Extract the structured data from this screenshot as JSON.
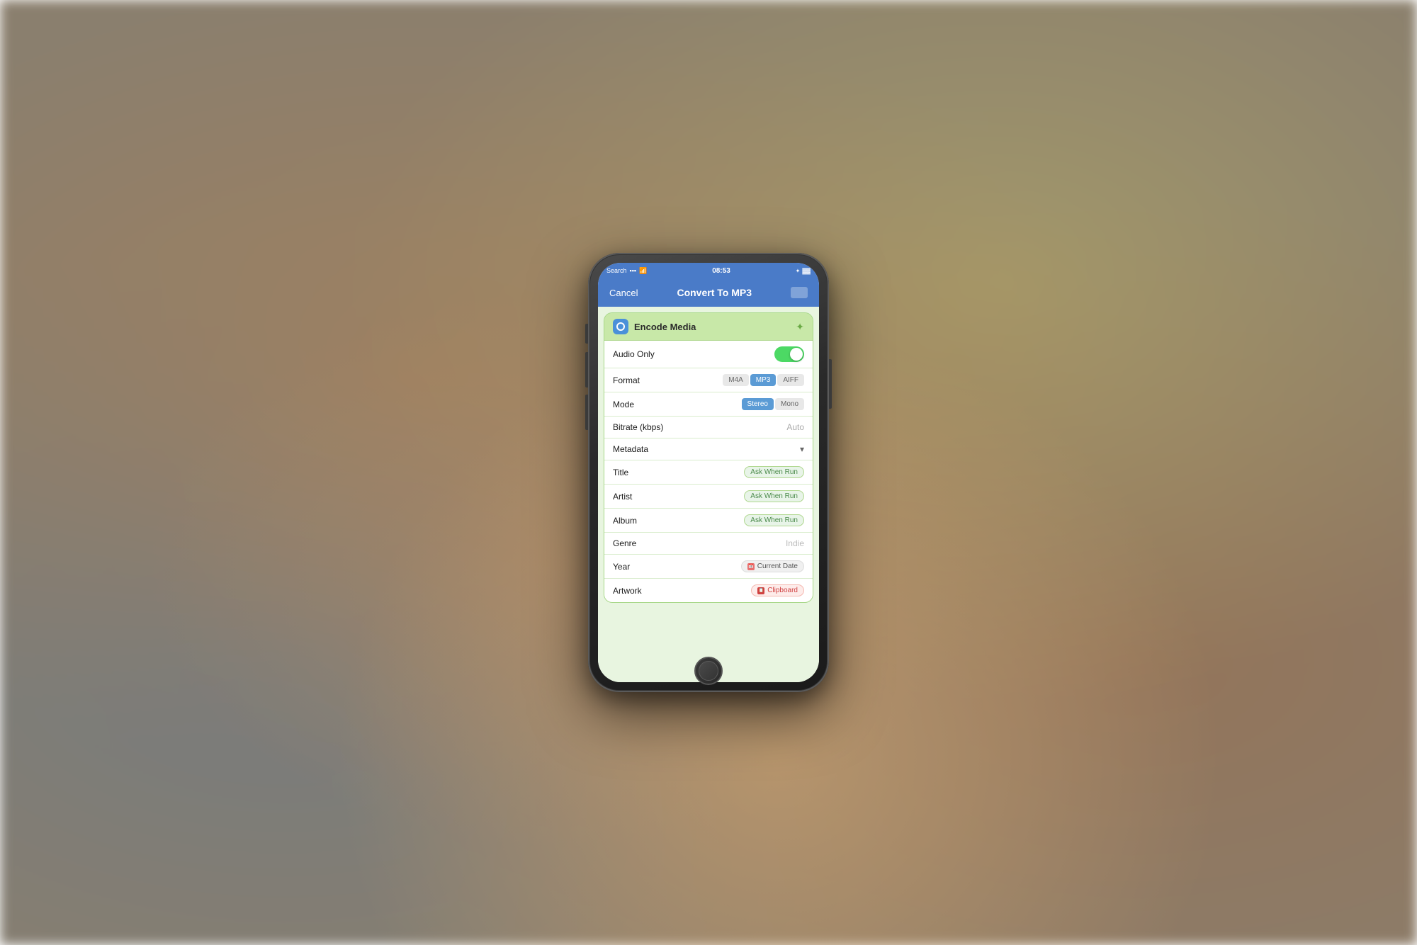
{
  "background": {
    "color": "#8a7f6e"
  },
  "status_bar": {
    "left_text": "Search",
    "time": "08:53",
    "right_icons": "▪ ✦ 🔋"
  },
  "nav": {
    "cancel_label": "Cancel",
    "title": "Convert To MP3",
    "icon_label": "□"
  },
  "card": {
    "header": {
      "icon": "encode",
      "title": "Encode Media",
      "expand_icon": "✦"
    },
    "rows": [
      {
        "id": "audio-only",
        "label": "Audio Only",
        "control": "toggle",
        "toggle_on": true
      },
      {
        "id": "format",
        "label": "Format",
        "control": "segmented",
        "options": [
          "M4A",
          "MP3",
          "AIFF"
        ],
        "selected": "MP3"
      },
      {
        "id": "mode",
        "label": "Mode",
        "control": "segmented",
        "options": [
          "Stereo",
          "Mono"
        ],
        "selected": "Stereo"
      },
      {
        "id": "bitrate",
        "label": "Bitrate (kbps)",
        "control": "text",
        "value": "Auto"
      },
      {
        "id": "metadata",
        "label": "Metadata",
        "control": "expand",
        "chevron": "▾"
      },
      {
        "id": "title",
        "label": "Title",
        "control": "badge",
        "badge_text": "Ask When Run",
        "badge_type": "ask"
      },
      {
        "id": "artist",
        "label": "Artist",
        "control": "badge",
        "badge_text": "Ask When Run",
        "badge_type": "ask"
      },
      {
        "id": "album",
        "label": "Album",
        "control": "badge",
        "badge_text": "Ask When Run",
        "badge_type": "ask"
      },
      {
        "id": "genre",
        "label": "Genre",
        "control": "text",
        "value": "Indie"
      },
      {
        "id": "year",
        "label": "Year",
        "control": "badge",
        "badge_text": "Current Date",
        "badge_type": "date"
      },
      {
        "id": "artwork",
        "label": "Artwork",
        "control": "badge",
        "badge_text": "Clipboard",
        "badge_type": "clipboard"
      }
    ]
  }
}
